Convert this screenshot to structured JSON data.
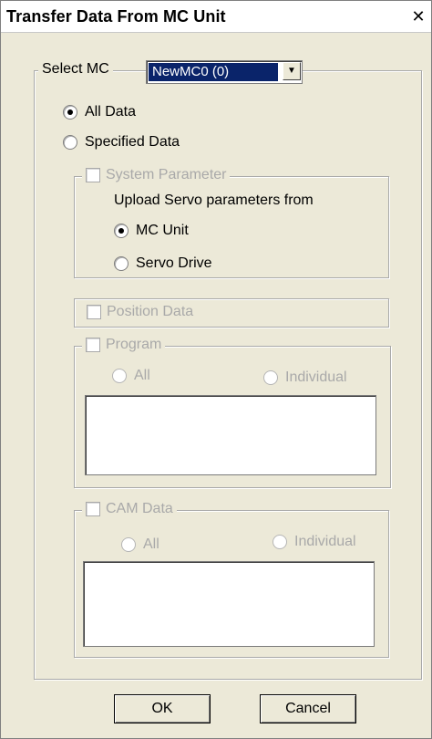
{
  "dialog": {
    "title": "Transfer Data From MC Unit",
    "close_glyph": "✕"
  },
  "select_mc": {
    "label": "Select MC",
    "value": "NewMC0 (0)"
  },
  "mode": {
    "all_data": "All Data",
    "specified_data": "Specified Data",
    "selected": "All Data"
  },
  "system_parameter": {
    "label": "System Parameter",
    "upload_text": "Upload Servo parameters from",
    "mc_unit": "MC Unit",
    "servo_drive": "Servo Drive",
    "selected": "MC Unit"
  },
  "position_data": {
    "label": "Position Data"
  },
  "program": {
    "label": "Program",
    "all": "All",
    "individual": "Individual"
  },
  "cam_data": {
    "label": "CAM Data",
    "all": "All",
    "individual": "Individual"
  },
  "buttons": {
    "ok": "OK",
    "cancel": "Cancel"
  }
}
